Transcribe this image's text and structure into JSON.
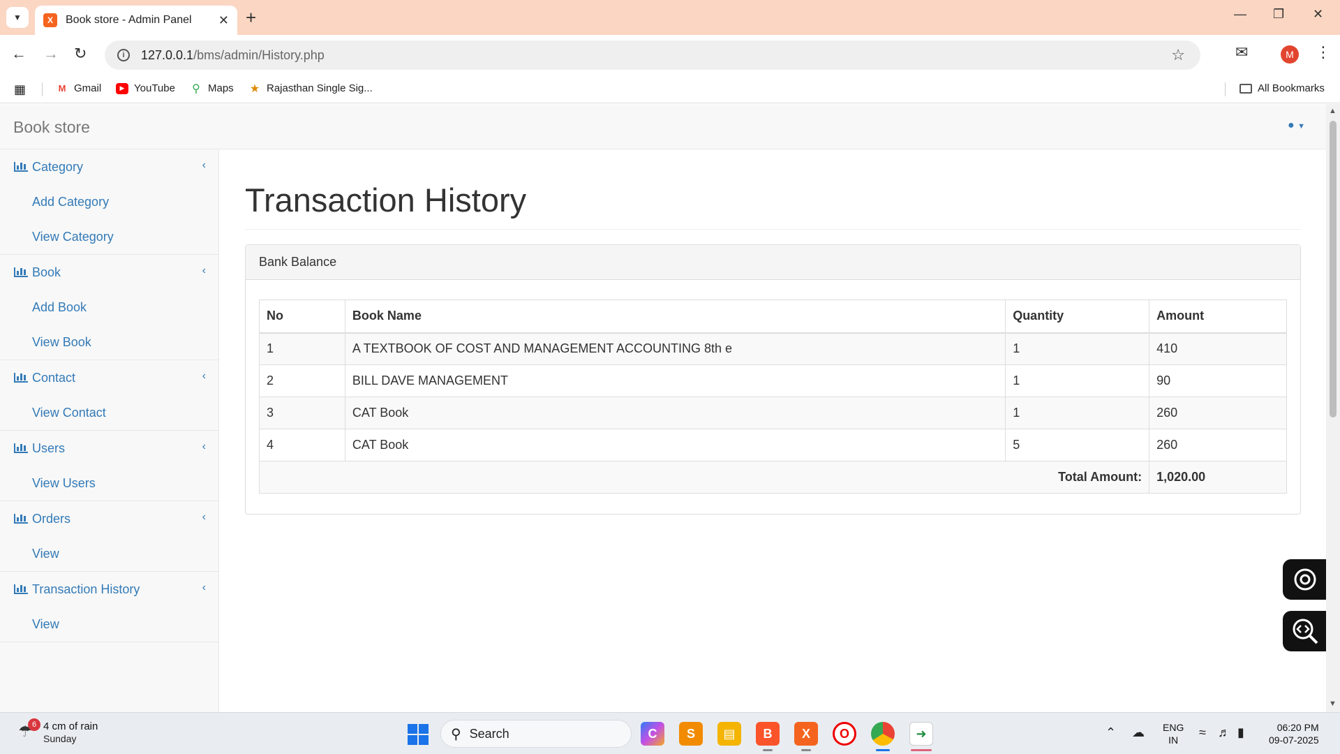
{
  "browser": {
    "tab_title": "Book store - Admin Panel",
    "tab_favicon": "X",
    "url_host": "127.0.0.1",
    "url_path": "/bms/admin/History.php",
    "profile_initial": "M",
    "bookmarks": [
      {
        "label": "Gmail",
        "icon": "gmail-icon"
      },
      {
        "label": "YouTube",
        "icon": "youtube-icon"
      },
      {
        "label": "Maps",
        "icon": "maps-icon"
      },
      {
        "label": "Rajasthan Single Sig...",
        "icon": "rajasthan-icon"
      }
    ],
    "all_bookmarks": "All Bookmarks"
  },
  "app": {
    "brand": "Book store",
    "page_title": "Transaction History",
    "panel_title": "Bank Balance"
  },
  "sidebar": [
    {
      "label": "Category",
      "items": [
        "Add Category",
        "View Category"
      ]
    },
    {
      "label": "Book",
      "items": [
        "Add Book",
        "View Book"
      ]
    },
    {
      "label": "Contact",
      "items": [
        "View Contact"
      ]
    },
    {
      "label": "Users",
      "items": [
        "View Users"
      ]
    },
    {
      "label": "Orders",
      "items": [
        "View"
      ]
    },
    {
      "label": "Transaction History",
      "items": [
        "View"
      ]
    }
  ],
  "table": {
    "headers": [
      "No",
      "Book Name",
      "Quantity",
      "Amount"
    ],
    "rows": [
      [
        "1",
        "A TEXTBOOK OF COST AND MANAGEMENT ACCOUNTING 8th e",
        "1",
        "410"
      ],
      [
        "2",
        "BILL DAVE MANAGEMENT",
        "1",
        "90"
      ],
      [
        "3",
        "CAT Book",
        "1",
        "260"
      ],
      [
        "4",
        "CAT Book",
        "5",
        "260"
      ]
    ],
    "total_label": "Total Amount:",
    "total_value": "1,020.00"
  },
  "taskbar": {
    "weather_badge": "6",
    "weather_title": "4 cm of rain",
    "weather_day": "Sunday",
    "search_label": "Search",
    "lang_top": "ENG",
    "lang_bottom": "IN",
    "time": "06:20 PM",
    "date": "09-07-2025"
  },
  "colors": {
    "tabbar": "#fbd6c2",
    "link": "#337ab7",
    "taskbar": "#e9edf2"
  }
}
